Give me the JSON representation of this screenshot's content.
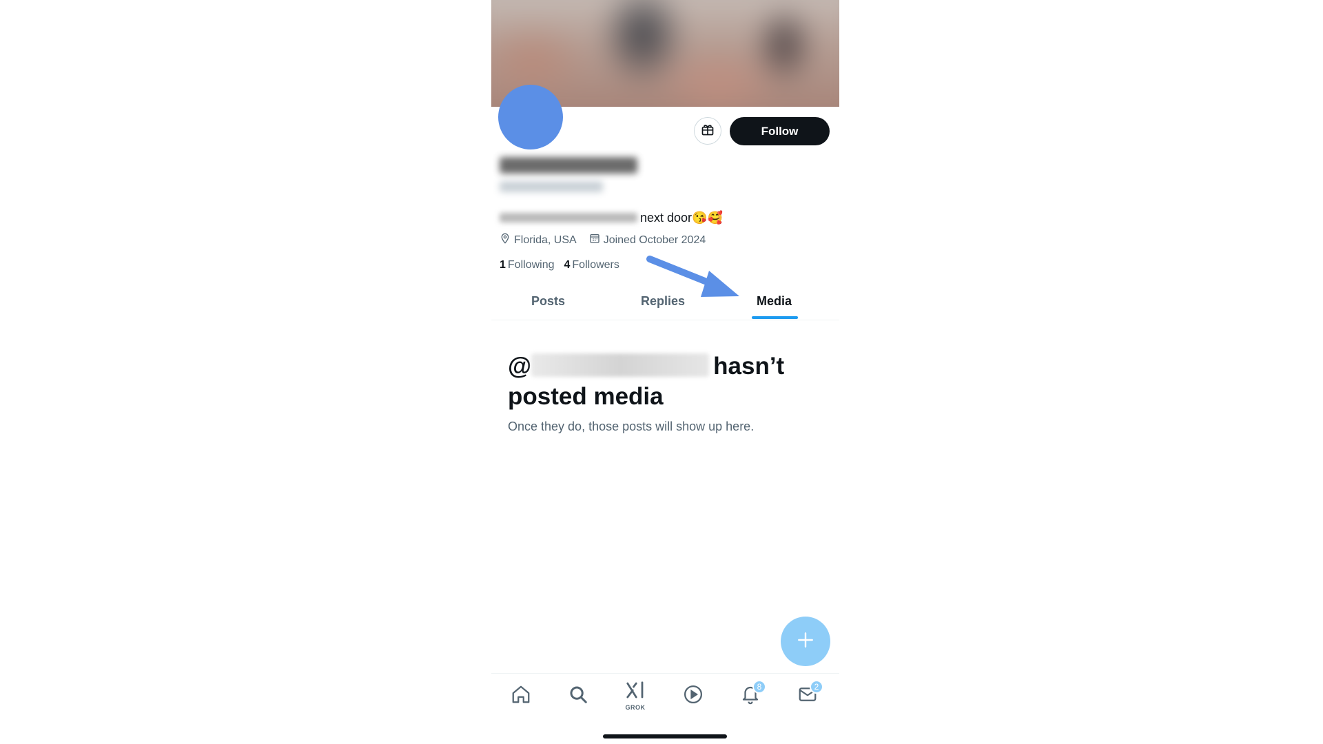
{
  "profile": {
    "bio_visible": "next door",
    "bio_emoji": "😘🥰",
    "location": "Florida, USA",
    "joined": "Joined October 2024",
    "following_count": "1",
    "following_label": "Following",
    "followers_count": "4",
    "followers_label": "Followers",
    "follow_label": "Follow"
  },
  "tabs": [
    {
      "label": "Posts",
      "active": false
    },
    {
      "label": "Replies",
      "active": false
    },
    {
      "label": "Media",
      "active": true
    }
  ],
  "empty_state": {
    "title_prefix": "@",
    "title_suffix": "hasn’t",
    "title_line2": "posted media",
    "subtitle": "Once they do, those posts will show up here."
  },
  "nav": {
    "grok_label": "GROK",
    "notifications_badge": "8",
    "messages_badge": "2"
  },
  "colors": {
    "accent": "#1d9bf0",
    "fab": "#8ecdf8",
    "avatar": "#5b8fe6",
    "annotation_arrow": "#5b8fe6"
  },
  "icons": [
    "gift-icon",
    "location-pin-icon",
    "calendar-icon",
    "plus-icon",
    "home-icon",
    "search-icon",
    "grok-icon",
    "play-icon",
    "bell-icon",
    "mail-icon"
  ]
}
